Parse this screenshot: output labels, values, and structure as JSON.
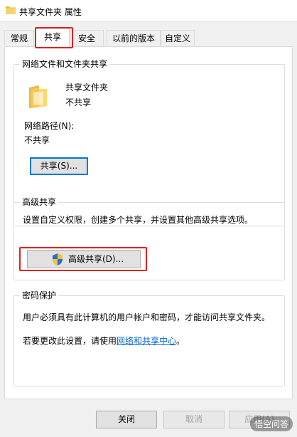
{
  "window": {
    "title": "共享文件夹 属性"
  },
  "tabs": [
    {
      "label": "常规"
    },
    {
      "label": "共享"
    },
    {
      "label": "安全"
    },
    {
      "label": "以前的版本"
    },
    {
      "label": "自定义"
    }
  ],
  "network_sharing": {
    "group_title": "网络文件和文件夹共享",
    "folder_name": "共享文件夹",
    "share_status": "不共享",
    "path_label": "网络路径(N):",
    "path_value": "不共享",
    "share_button": "共享(S)..."
  },
  "advanced_sharing": {
    "group_title": "高级共享",
    "description": "设置自定义权限，创建多个共享，并设置其他高级共享选项。",
    "button": "高级共享(D)..."
  },
  "password_protection": {
    "group_title": "密码保护",
    "description": "用户必须具有此计算机的用户帐户和密码，才能访问共享文件夹。",
    "change_prefix": "若要更改此设置，请使用",
    "link_text": "网络和共享中心",
    "change_suffix": "。"
  },
  "footer": {
    "close": "关闭",
    "cancel": "取消",
    "apply": "应用(A)"
  },
  "watermark": "悟空问答"
}
